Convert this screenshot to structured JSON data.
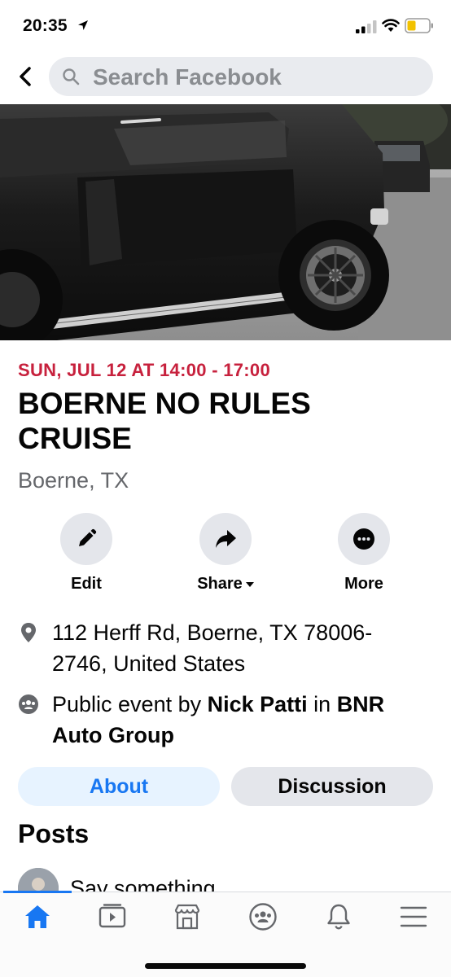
{
  "status_bar": {
    "time": "20:35"
  },
  "search": {
    "placeholder": "Search Facebook"
  },
  "event": {
    "date": "SUN, JUL 12 AT 14:00 - 17:00",
    "title": "BOERNE NO RULES CRUISE",
    "location": "Boerne, TX"
  },
  "actions": {
    "edit": "Edit",
    "share": "Share",
    "more": "More"
  },
  "details": {
    "address": "112 Herff Rd, Boerne, TX 78006-2746, United States",
    "host_prefix": "Public event by ",
    "host_name": "Nick Patti",
    "host_mid": " in ",
    "host_group": "BNR Auto Group"
  },
  "tabs": {
    "about": "About",
    "discussion": "Discussion"
  },
  "posts": {
    "heading": "Posts",
    "composer_placeholder": "Say something..."
  },
  "colors": {
    "accent": "#1877f2",
    "date_red": "#c7213d",
    "muted": "#65676b"
  },
  "icons": [
    "location-arrow-icon",
    "signal-icon",
    "wifi-icon",
    "battery-icon",
    "back-icon",
    "search-icon",
    "pencil-icon",
    "share-arrow-icon",
    "more-icon",
    "pin-icon",
    "group-icon",
    "home-icon",
    "watch-icon",
    "marketplace-icon",
    "groups-icon",
    "bell-icon",
    "menu-icon"
  ]
}
